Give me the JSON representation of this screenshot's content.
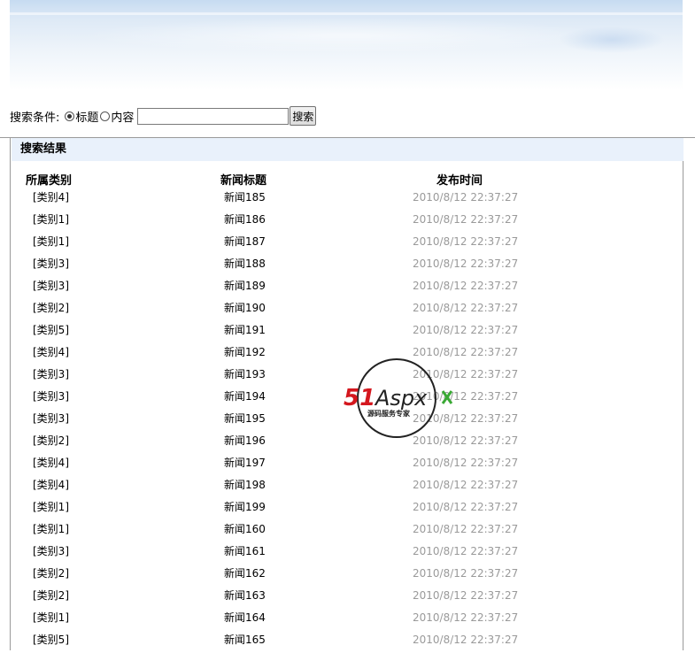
{
  "search": {
    "label": "搜索条件:",
    "option_title": "标题",
    "option_content": "内容",
    "selected": "标题",
    "input_value": "",
    "button_label": "搜索"
  },
  "results": {
    "header": "搜索结果",
    "columns": [
      "所属类别",
      "新闻标题",
      "发布时间"
    ],
    "rows": [
      {
        "category": "[类别4]",
        "title": "新闻185",
        "time": "2010/8/12 22:37:27"
      },
      {
        "category": "[类别1]",
        "title": "新闻186",
        "time": "2010/8/12 22:37:27"
      },
      {
        "category": "[类别1]",
        "title": "新闻187",
        "time": "2010/8/12 22:37:27"
      },
      {
        "category": "[类别3]",
        "title": "新闻188",
        "time": "2010/8/12 22:37:27"
      },
      {
        "category": "[类别3]",
        "title": "新闻189",
        "time": "2010/8/12 22:37:27"
      },
      {
        "category": "[类别2]",
        "title": "新闻190",
        "time": "2010/8/12 22:37:27"
      },
      {
        "category": "[类别5]",
        "title": "新闻191",
        "time": "2010/8/12 22:37:27"
      },
      {
        "category": "[类别4]",
        "title": "新闻192",
        "time": "2010/8/12 22:37:27"
      },
      {
        "category": "[类别3]",
        "title": "新闻193",
        "time": "2010/8/12 22:37:27"
      },
      {
        "category": "[类别3]",
        "title": "新闻194",
        "time": "2010/8/12 22:37:27"
      },
      {
        "category": "[类别3]",
        "title": "新闻195",
        "time": "2010/8/12 22:37:27"
      },
      {
        "category": "[类别2]",
        "title": "新闻196",
        "time": "2010/8/12 22:37:27"
      },
      {
        "category": "[类别4]",
        "title": "新闻197",
        "time": "2010/8/12 22:37:27"
      },
      {
        "category": "[类别4]",
        "title": "新闻198",
        "time": "2010/8/12 22:37:27"
      },
      {
        "category": "[类别1]",
        "title": "新闻199",
        "time": "2010/8/12 22:37:27"
      },
      {
        "category": "[类别1]",
        "title": "新闻160",
        "time": "2010/8/12 22:37:27"
      },
      {
        "category": "[类别3]",
        "title": "新闻161",
        "time": "2010/8/12 22:37:27"
      },
      {
        "category": "[类别2]",
        "title": "新闻162",
        "time": "2010/8/12 22:37:27"
      },
      {
        "category": "[类别2]",
        "title": "新闻163",
        "time": "2010/8/12 22:37:27"
      },
      {
        "category": "[类别1]",
        "title": "新闻164",
        "time": "2010/8/12 22:37:27"
      },
      {
        "category": "[类别5]",
        "title": "新闻165",
        "time": "2010/8/12 22:37:27"
      }
    ]
  },
  "watermark": {
    "brand_51": "51",
    "brand_aspx": "Aspx",
    "tagline": "源码服务专家",
    "colors": {
      "red": "#d4171e",
      "green": "#3aa935",
      "dark": "#222222"
    }
  },
  "colors": {
    "header_bg": "#e9f1fb",
    "time_text": "#9a9a9a",
    "border": "#9a9a9a"
  }
}
